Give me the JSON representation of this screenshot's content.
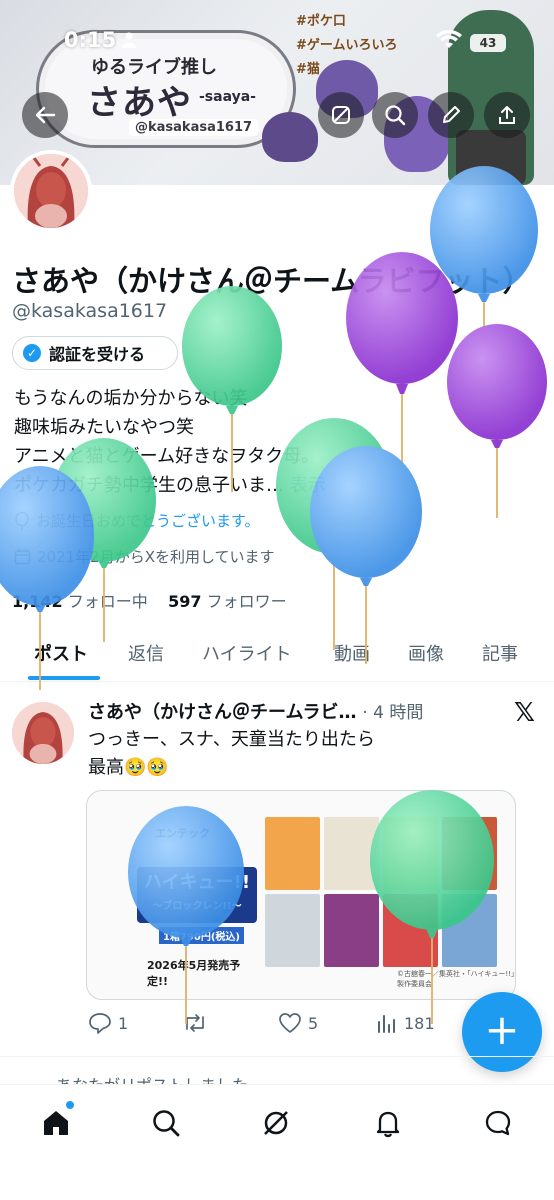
{
  "status": {
    "time": "0:15",
    "battery": "43"
  },
  "banner": {
    "line1": "ゆるライブ推し",
    "name": "さあや",
    "romaji": "-saaya-",
    "handle": "@kasakasa1617",
    "tags": [
      "#ポケ口",
      "#ゲームいろいろ",
      "#猫"
    ]
  },
  "profile": {
    "display_name": "さあや（かけさん＠チームラビフット）",
    "handle": "@kasakasa1617",
    "verify_label": "認証を受ける",
    "bio_lines": [
      "もうなんの垢か分からない笑",
      "趣味垢みたいなやつ笑",
      "アニメと猫とゲーム好きなヲタク母。",
      "ポケカガチ勢中学生の息子いま…"
    ],
    "bio_more": "表示",
    "birthday_prefix": "お誕生日おめで",
    "birthday_link": "とうございます。",
    "joined": "2021年2月からXを利用しています",
    "following_count": "1,142",
    "following_label": "フォロー中",
    "followers_count": "597",
    "followers_label": "フォロワー"
  },
  "tabs": [
    {
      "label": "ポスト",
      "active": true
    },
    {
      "label": "返信",
      "active": false
    },
    {
      "label": "ハイライト",
      "active": false
    },
    {
      "label": "動画",
      "active": false
    },
    {
      "label": "画像",
      "active": false
    },
    {
      "label": "記事",
      "active": false
    }
  ],
  "post": {
    "author": "さあや（かけさん＠チームラビ…",
    "time": "· 4 時間",
    "text_line1": "つっきー、スナ、天童当たり出たら",
    "text_line2": "最高🥹🥹",
    "media": {
      "tag": "エンテック",
      "title": "ハイキュー!!",
      "subtitle": "～ブロックレン!!～",
      "price": "1箱790円(税込)",
      "release": "2026年5月発売予定!!",
      "copyright": "©古舘春一／集英社・「ハイキュー!!」製作委員会"
    },
    "replies": "1",
    "likes": "5",
    "views": "181"
  },
  "repost_hint": "あなたがリポストしました",
  "colors": {
    "accent": "#1d9bf0",
    "text": "#0f1419",
    "muted": "#536471",
    "balloon_blue": "#5aa9f0",
    "balloon_purple": "#9b45d9",
    "balloon_green": "#5ed3a0"
  }
}
